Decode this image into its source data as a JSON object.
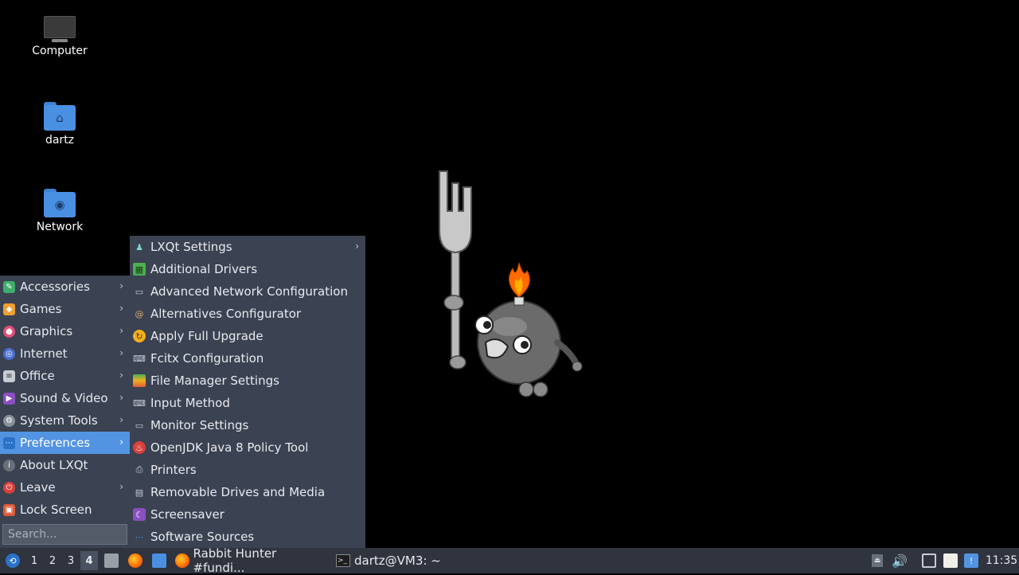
{
  "desktop": {
    "icons": [
      {
        "label": "Computer",
        "icon": "computer-icon"
      },
      {
        "label": "dartz",
        "icon": "home-folder-icon"
      },
      {
        "label": "Network",
        "icon": "network-folder-icon"
      }
    ]
  },
  "main_menu": {
    "items": [
      {
        "label": "Accessories",
        "icon": "accessories-icon",
        "submenu": true
      },
      {
        "label": "Games",
        "icon": "games-icon",
        "submenu": true
      },
      {
        "label": "Graphics",
        "icon": "graphics-icon",
        "submenu": true
      },
      {
        "label": "Internet",
        "icon": "internet-icon",
        "submenu": true
      },
      {
        "label": "Office",
        "icon": "office-icon",
        "submenu": true
      },
      {
        "label": "Sound & Video",
        "icon": "sound-video-icon",
        "submenu": true
      },
      {
        "label": "System Tools",
        "icon": "system-tools-icon",
        "submenu": true
      },
      {
        "label": "Preferences",
        "icon": "preferences-icon",
        "submenu": true,
        "selected": true
      },
      {
        "label": "About LXQt",
        "icon": "info-icon",
        "submenu": false
      },
      {
        "label": "Leave",
        "icon": "power-icon",
        "submenu": true
      },
      {
        "label": "Lock Screen",
        "icon": "lock-icon",
        "submenu": false
      }
    ],
    "search_placeholder": "Search..."
  },
  "preferences_menu": {
    "items": [
      {
        "label": "LXQt Settings",
        "icon": "lxqt-settings-icon",
        "submenu": true
      },
      {
        "label": "Additional Drivers",
        "icon": "drivers-icon"
      },
      {
        "label": "Advanced Network Configuration",
        "icon": "network-config-icon"
      },
      {
        "label": "Alternatives Configurator",
        "icon": "alternatives-icon"
      },
      {
        "label": "Apply Full Upgrade",
        "icon": "upgrade-icon"
      },
      {
        "label": "Fcitx Configuration",
        "icon": "keyboard-icon"
      },
      {
        "label": "File Manager Settings",
        "icon": "file-manager-icon"
      },
      {
        "label": "Input Method",
        "icon": "input-method-icon"
      },
      {
        "label": "Monitor Settings",
        "icon": "monitor-icon"
      },
      {
        "label": "OpenJDK Java 8 Policy Tool",
        "icon": "java-icon"
      },
      {
        "label": "Printers",
        "icon": "printer-icon"
      },
      {
        "label": "Removable Drives and Media",
        "icon": "drive-icon"
      },
      {
        "label": "Screensaver",
        "icon": "screensaver-icon"
      },
      {
        "label": "Software Sources",
        "icon": "software-sources-icon"
      }
    ]
  },
  "taskbar": {
    "workspaces": [
      "1",
      "2",
      "3",
      "4"
    ],
    "active_workspace": "4",
    "tasks": [
      {
        "label": "Rabbit Hunter #fundi...",
        "icon": "firefox-icon"
      },
      {
        "label": "dartz@VM3: ~",
        "icon": "terminal-icon"
      }
    ],
    "clock": "11:35"
  },
  "colors": {
    "menu_bg": "#3b4252",
    "selection": "#5294e2",
    "taskbar_bg": "#2f343f"
  }
}
